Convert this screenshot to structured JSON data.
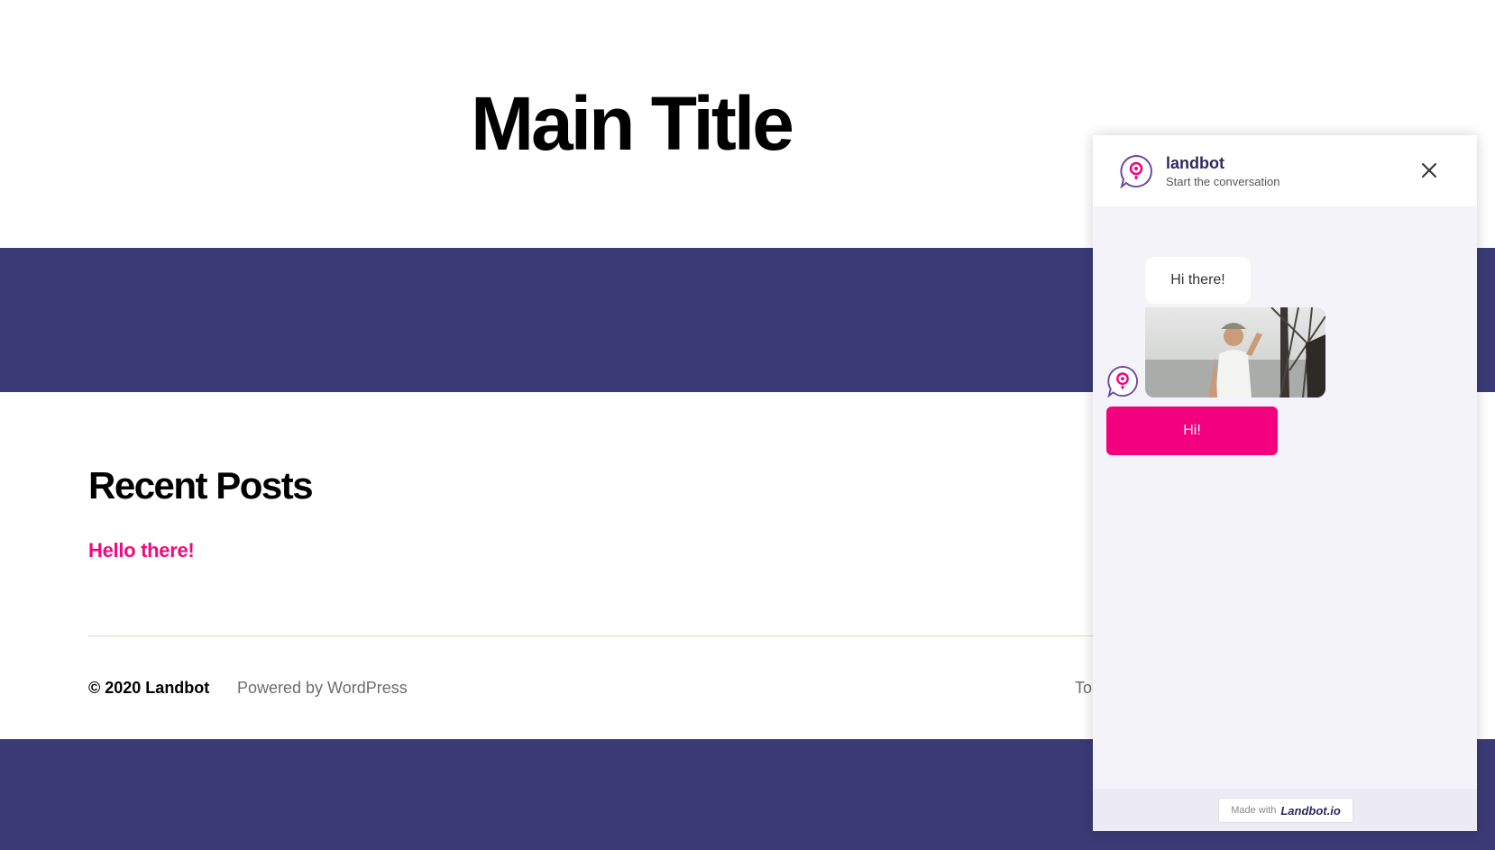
{
  "page": {
    "title": "Main Title",
    "section_heading": "Recent Posts",
    "posts": [
      "Hello there!"
    ],
    "footer": {
      "copyright": "© 2020 Landbot",
      "powered_by": "Powered by WordPress",
      "to_top": "To"
    },
    "colors": {
      "band": "#3c3a76",
      "link": "#f00a7f"
    }
  },
  "chat": {
    "title": "landbot",
    "subtitle": "Start the conversation",
    "messages": [
      "Hi there!"
    ],
    "reply_button": "Hi!",
    "made_with_label": "Made with",
    "made_with_brand": "Landbot.io",
    "colors": {
      "accent": "#f2007d",
      "background": "#f4f3fa",
      "title": "#2f2a5e"
    },
    "icons": {
      "logo": "landbot-logo-icon",
      "close": "close-icon"
    }
  }
}
